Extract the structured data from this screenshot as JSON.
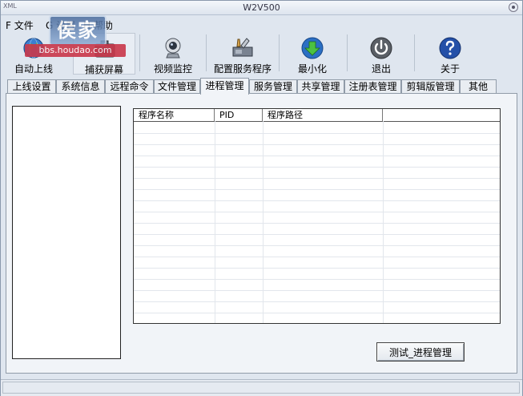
{
  "window": {
    "app_label": "XML",
    "title": "W2V500"
  },
  "menu": [
    {
      "label": "F 文件"
    },
    {
      "label": "G 设置"
    },
    {
      "label": "H 帮助"
    }
  ],
  "watermark": {
    "logo_text": "侯家",
    "url": "bbs.houdao.com"
  },
  "toolbar": [
    {
      "label": "自动上线",
      "icon": "globe-icon"
    },
    {
      "label": "捕获屏幕",
      "icon": "camera-icon"
    },
    {
      "label": "视频监控",
      "icon": "webcam-icon"
    },
    {
      "label": "配置服务程序",
      "icon": "tools-icon"
    },
    {
      "label": "最小化",
      "icon": "minimize-down-arrow-icon"
    },
    {
      "label": "退出",
      "icon": "power-icon"
    },
    {
      "label": "关于",
      "icon": "help-icon"
    }
  ],
  "tabs": [
    {
      "label": "上线设置"
    },
    {
      "label": "系统信息"
    },
    {
      "label": "远程命令"
    },
    {
      "label": "文件管理"
    },
    {
      "label": "进程管理"
    },
    {
      "label": "服务管理"
    },
    {
      "label": "共享管理"
    },
    {
      "label": "注册表管理"
    },
    {
      "label": "剪辑版管理"
    },
    {
      "label": "其他"
    }
  ],
  "active_tab": "进程管理",
  "process_table": {
    "columns": [
      "程序名称",
      "PID",
      "程序路径",
      ""
    ],
    "rows": []
  },
  "action_button": {
    "label": "测试_进程管理"
  },
  "colors": {
    "window_bg": "#dfe6ef",
    "accent_blue": "#2b6fc4",
    "exit_grey": "#5a5f66",
    "help_blue": "#2450a8",
    "minimize_green": "#3aa63a"
  }
}
